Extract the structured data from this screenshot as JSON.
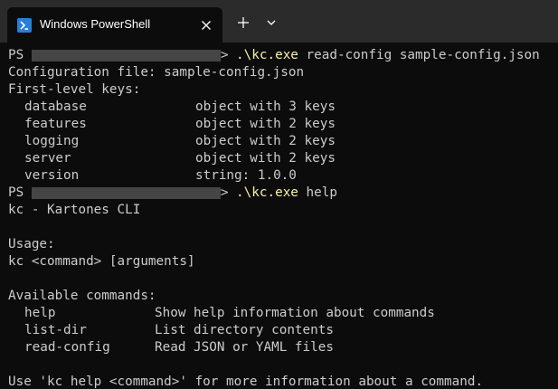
{
  "tab": {
    "title": "Windows PowerShell",
    "icon": "powershell-icon"
  },
  "colors": {
    "background": "#0c0c0c",
    "titlebar": "#2b2b2b",
    "text": "#cccccc",
    "command": "#f9f1a5",
    "redaction": "#454545",
    "tab_icon": "#2a7fd4"
  },
  "prompts": [
    {
      "ps": "PS ",
      "gt": "> ",
      "command": ".\\kc.exe",
      "args": " read-config sample-config.json"
    },
    {
      "ps": "PS ",
      "gt": "> ",
      "command": ".\\kc.exe",
      "args": " help"
    }
  ],
  "read_config": {
    "config_line": "Configuration file: sample-config.json",
    "keys_header": "First-level keys:",
    "keys": [
      {
        "name": "database",
        "desc": "object with 3 keys"
      },
      {
        "name": "features",
        "desc": "object with 2 keys"
      },
      {
        "name": "logging",
        "desc": "object with 2 keys"
      },
      {
        "name": "server",
        "desc": "object with 2 keys"
      },
      {
        "name": "version",
        "desc": "string: 1.0.0"
      }
    ]
  },
  "help": {
    "title": "kc - Kartones CLI",
    "usage_header": "Usage:",
    "usage": "kc <command> [arguments]",
    "commands_header": "Available commands:",
    "commands": [
      {
        "name": "help",
        "desc": "Show help information about commands"
      },
      {
        "name": "list-dir",
        "desc": "List directory contents"
      },
      {
        "name": "read-config",
        "desc": "Read JSON or YAML files"
      }
    ],
    "footer": "Use 'kc help <command>' for more information about a command."
  }
}
